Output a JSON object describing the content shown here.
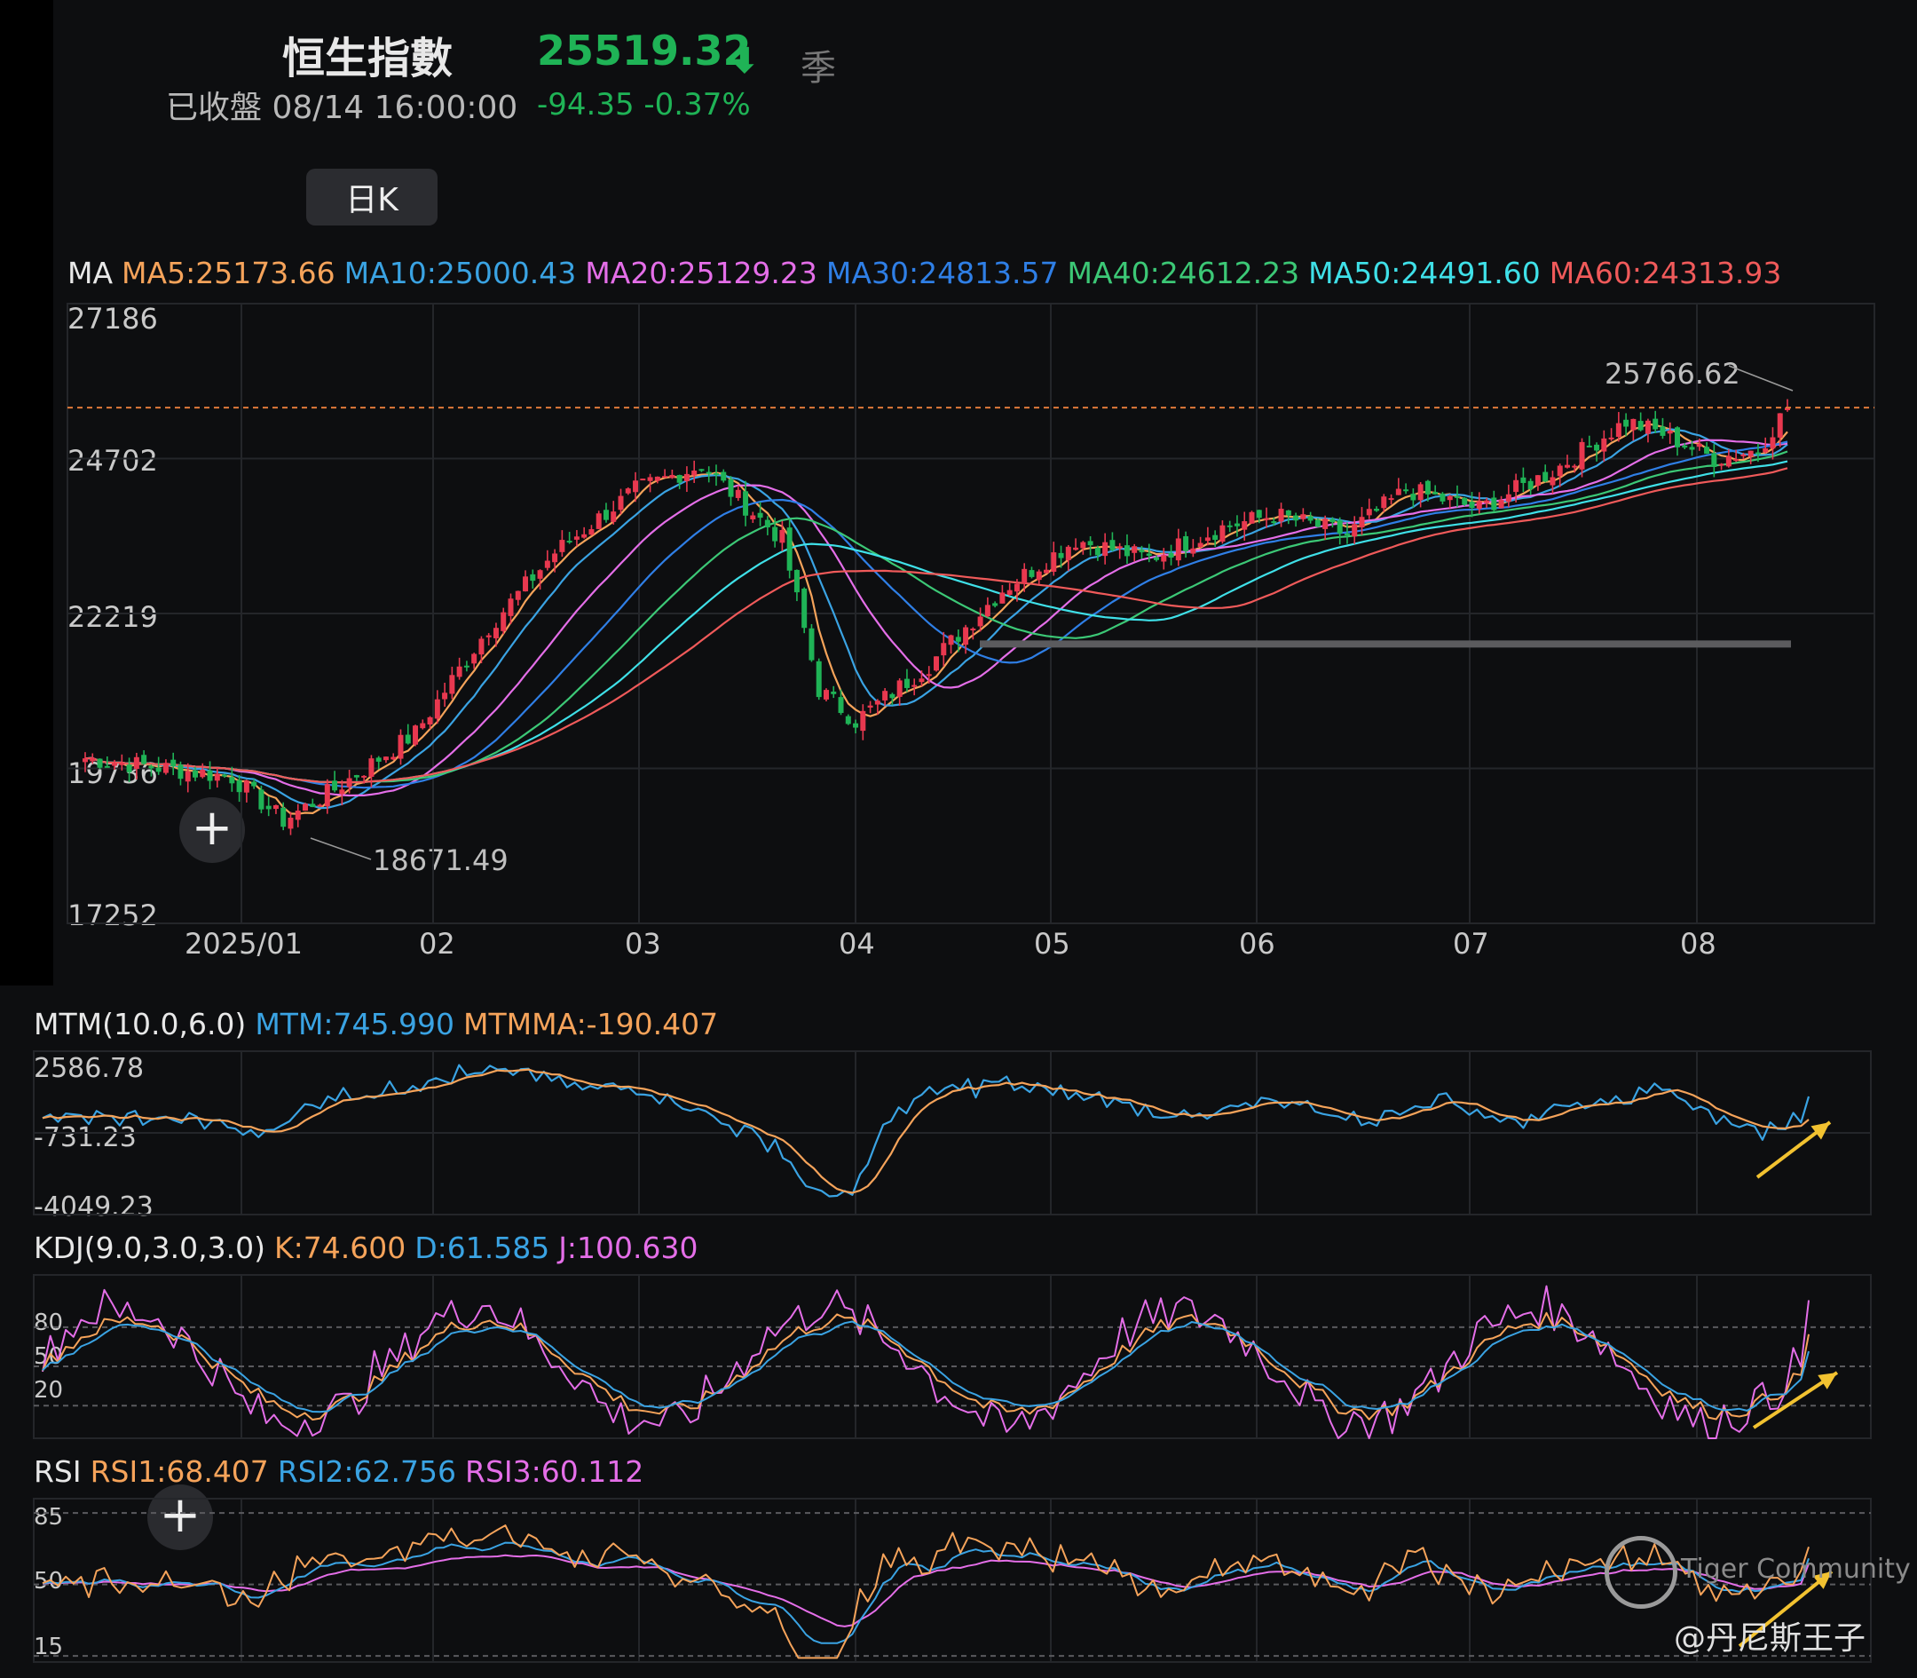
{
  "header": {
    "title": "恒生指數",
    "price": "25519.32",
    "status": "已收盤 08/14 16:00:00",
    "change": "-94.35 -0.37%",
    "corner_glyph": "季",
    "timeframe_button": "日K"
  },
  "icons": {
    "price_direction": "arrow-down-icon",
    "add": "plus-icon",
    "brand": "tiger-logo-icon"
  },
  "colors": {
    "up": "#e8384f",
    "down": "#1fb356",
    "MA5": "#f5a35a",
    "MA10": "#3aa3e3",
    "MA20": "#e46ee8",
    "MA30": "#2f7fe6",
    "MA40": "#3cc876",
    "MA50": "#3fe0e8",
    "MA60": "#f05a5a",
    "MTM": "#3aa3e3",
    "MTMMA": "#f5a35a",
    "K": "#f5a35a",
    "D": "#3aa3e3",
    "J": "#e46ee8",
    "RSI1": "#f5a35a",
    "RSI2": "#3aa3e3",
    "RSI3": "#e46ee8"
  },
  "chart_data": [
    {
      "type": "candlestick",
      "legend_label": "MA",
      "legend": [
        "MA5:25173.66",
        "MA10:25000.43",
        "MA20:25129.23",
        "MA30:24813.57",
        "MA40:24612.23",
        "MA50:24491.60",
        "MA60:24313.93"
      ],
      "ma_names": [
        "MA5",
        "MA10",
        "MA20",
        "MA30",
        "MA40",
        "MA50",
        "MA60"
      ],
      "y_ticks": [
        "27186",
        "24702",
        "22219",
        "19736",
        "17252"
      ],
      "ylim": [
        17252,
        27186
      ],
      "x_ticks": [
        "2025/01",
        "02",
        "03",
        "04",
        "05",
        "06",
        "07",
        "08"
      ],
      "annotations": {
        "high_label": "25766.62",
        "low_label": "18671.49",
        "high": 25766.62,
        "low": 18671.49
      },
      "reference_line": 25519.32,
      "support_level": 21730,
      "anchors_close": [
        [
          0,
          19900
        ],
        [
          10,
          19750
        ],
        [
          20,
          19600
        ],
        [
          27,
          18900
        ],
        [
          34,
          19400
        ],
        [
          45,
          20300
        ],
        [
          55,
          22000
        ],
        [
          64,
          23200
        ],
        [
          75,
          24200
        ],
        [
          84,
          24600
        ],
        [
          95,
          23400
        ],
        [
          100,
          21000
        ],
        [
          105,
          20500
        ],
        [
          115,
          21400
        ],
        [
          125,
          22600
        ],
        [
          135,
          23400
        ],
        [
          145,
          23100
        ],
        [
          155,
          23600
        ],
        [
          162,
          23800
        ],
        [
          172,
          23500
        ],
        [
          180,
          24200
        ],
        [
          190,
          23900
        ],
        [
          200,
          24500
        ],
        [
          210,
          25300
        ],
        [
          215,
          25100
        ],
        [
          222,
          24700
        ],
        [
          228,
          24850
        ],
        [
          232,
          25519
        ]
      ],
      "last_close": 25519.32
    },
    {
      "type": "line",
      "name": "MTM(10.0,6.0)",
      "legend": [
        "MTM:745.990",
        "MTMMA:-190.407"
      ],
      "y_ticks": [
        "2586.78",
        "-731.23",
        "-4049.23"
      ],
      "ylim": [
        -4049.23,
        2586.78
      ],
      "last": {
        "MTM": 745.99,
        "MTMMA": -190.407
      }
    },
    {
      "type": "line",
      "name": "KDJ(9.0,3.0,3.0)",
      "legend": [
        "K:74.600",
        "D:61.585",
        "J:100.630"
      ],
      "y_ticks": [
        "80",
        "50",
        "20"
      ],
      "ylim": [
        -5,
        120
      ],
      "last": {
        "K": 74.6,
        "D": 61.585,
        "J": 100.63
      }
    },
    {
      "type": "line",
      "name": "RSI",
      "legend": [
        "RSI1:68.407",
        "RSI2:62.756",
        "RSI3:60.112"
      ],
      "y_ticks": [
        "85",
        "50",
        "15"
      ],
      "ylim": [
        12,
        92
      ],
      "last": {
        "RSI1": 68.407,
        "RSI2": 62.756,
        "RSI3": 60.112
      }
    }
  ],
  "watermark": {
    "brand": "Tiger Community",
    "author": "@丹尼斯王子"
  }
}
